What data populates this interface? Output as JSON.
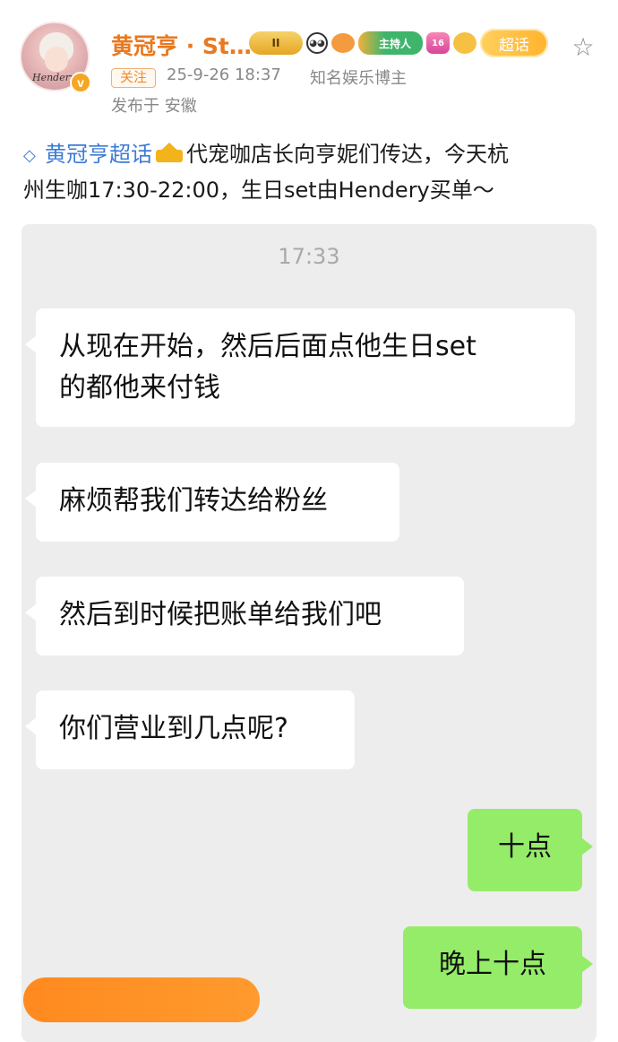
{
  "header": {
    "username": "黄冠亨 · St…",
    "avatar_signature": "Hendery",
    "verified_mark": "v",
    "badges": {
      "crown_level": "II",
      "host": "主持人",
      "level": "16",
      "super_topic": "超话"
    },
    "follow_label": "关注",
    "timestamp": "25-9-26 18:37",
    "role": "知名娱乐博主",
    "location": "发布于 安徽",
    "star_icon": "☆"
  },
  "post": {
    "topic_icon": "◇",
    "topic": "黄冠亨超话",
    "text_line1": "代宠咖店长向亨妮们传达，今天杭",
    "text_line2": "州生咖17:30-22:00，生日set由Hendery买单～"
  },
  "chat": {
    "time": "17:33",
    "messages": [
      {
        "side": "in",
        "text_line1": "从现在开始，然后后面点他生日set",
        "text_line2": "的都他来付钱"
      },
      {
        "side": "in",
        "text": "麻烦帮我们转达给粉丝"
      },
      {
        "side": "in",
        "text": "然后到时候把账单给我们吧"
      },
      {
        "side": "in",
        "text": "你们营业到几点呢?"
      },
      {
        "side": "out",
        "text": "十点"
      },
      {
        "side": "out",
        "text": "晚上十点"
      }
    ]
  },
  "colors": {
    "username": "#e8791f",
    "topic_link": "#3d7bd4",
    "outgoing_bubble": "#95ec69",
    "chat_background": "#ededed",
    "orange_bar": "#ff8a1f"
  }
}
